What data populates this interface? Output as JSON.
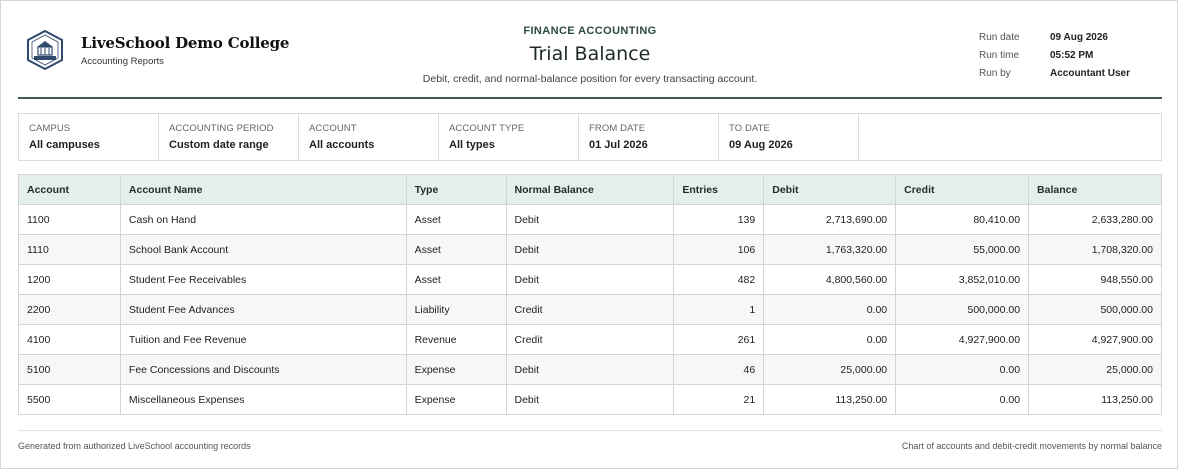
{
  "brand": {
    "name": "LiveSchool Demo College",
    "subtitle": "Accounting Reports"
  },
  "report": {
    "eyebrow": "FINANCE ACCOUNTING",
    "title": "Trial Balance",
    "description": "Debit, credit, and normal-balance position for every transacting account."
  },
  "meta": [
    {
      "label": "Run date",
      "value": "09 Aug 2026"
    },
    {
      "label": "Run time",
      "value": "05:52 PM"
    },
    {
      "label": "Run by",
      "value": "Accountant User"
    }
  ],
  "filters": [
    {
      "label": "Campus",
      "value": "All campuses"
    },
    {
      "label": "Accounting Period",
      "value": "Custom date range"
    },
    {
      "label": "Account",
      "value": "All accounts"
    },
    {
      "label": "Account Type",
      "value": "All types"
    },
    {
      "label": "From Date",
      "value": "01 Jul 2026"
    },
    {
      "label": "To Date",
      "value": "09 Aug 2026"
    }
  ],
  "table": {
    "headers": [
      "Account",
      "Account Name",
      "Type",
      "Normal Balance",
      "Entries",
      "Debit",
      "Credit",
      "Balance"
    ],
    "rows": [
      [
        "1100",
        "Cash on Hand",
        "Asset",
        "Debit",
        "139",
        "2,713,690.00",
        "80,410.00",
        "2,633,280.00"
      ],
      [
        "1110",
        "School Bank Account",
        "Asset",
        "Debit",
        "106",
        "1,763,320.00",
        "55,000.00",
        "1,708,320.00"
      ],
      [
        "1200",
        "Student Fee Receivables",
        "Asset",
        "Debit",
        "482",
        "4,800,560.00",
        "3,852,010.00",
        "948,550.00"
      ],
      [
        "2200",
        "Student Fee Advances",
        "Liability",
        "Credit",
        "1",
        "0.00",
        "500,000.00",
        "500,000.00"
      ],
      [
        "4100",
        "Tuition and Fee Revenue",
        "Revenue",
        "Credit",
        "261",
        "0.00",
        "4,927,900.00",
        "4,927,900.00"
      ],
      [
        "5100",
        "Fee Concessions and Discounts",
        "Expense",
        "Debit",
        "46",
        "25,000.00",
        "0.00",
        "25,000.00"
      ],
      [
        "5500",
        "Miscellaneous Expenses",
        "Expense",
        "Debit",
        "21",
        "113,250.00",
        "0.00",
        "113,250.00"
      ]
    ]
  },
  "footer": {
    "left": "Generated from authorized LiveSchool accounting records",
    "right": "Chart of accounts and debit-credit movements by normal balance"
  },
  "colors": {
    "accent": "#3d5a57",
    "header_bg": "#e3efec",
    "logo": "#2f4a6e"
  },
  "icons": {
    "logo": "school-crest-icon"
  }
}
